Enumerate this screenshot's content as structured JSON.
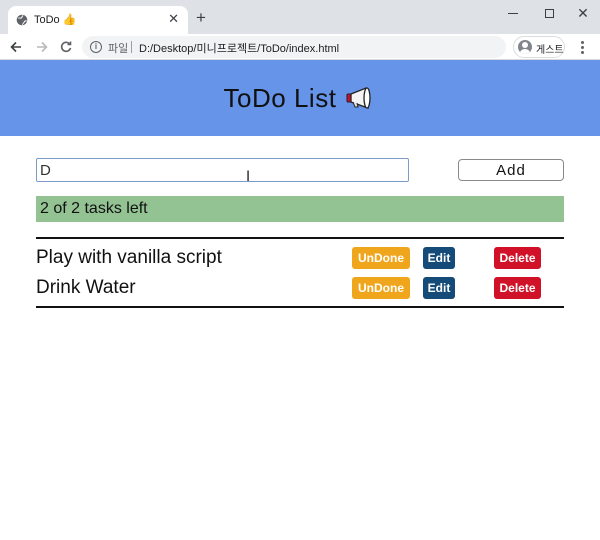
{
  "browser": {
    "tab_title": "ToDo 👍",
    "new_tab_symbol": "+",
    "scheme_label": "파일",
    "url": "D:/Desktop/미니프로젝트/ToDo/index.html",
    "profile_label": "게스트"
  },
  "app": {
    "title": "ToDo List",
    "header_color": "#6694e9",
    "input_value": "D",
    "add_label": "Add",
    "status_text": "2 of 2 tasks left",
    "status_color": "#93c293"
  },
  "tasks": [
    {
      "text": "Play with vanilla script",
      "undone_label": "UnDone",
      "edit_label": "Edit",
      "delete_label": "Delete"
    },
    {
      "text": "Drink Water",
      "undone_label": "UnDone",
      "edit_label": "Edit",
      "delete_label": "Delete"
    }
  ],
  "colors": {
    "undone": "#f0a61c",
    "edit": "#154b78",
    "delete": "#d01127"
  },
  "icons": [
    "globe-icon",
    "close-icon",
    "plus-icon",
    "minimize-icon",
    "maximize-icon",
    "back-icon",
    "forward-icon",
    "reload-icon",
    "info-icon",
    "avatar-icon",
    "menu-icon",
    "megaphone-icon",
    "text-cursor-icon"
  ]
}
